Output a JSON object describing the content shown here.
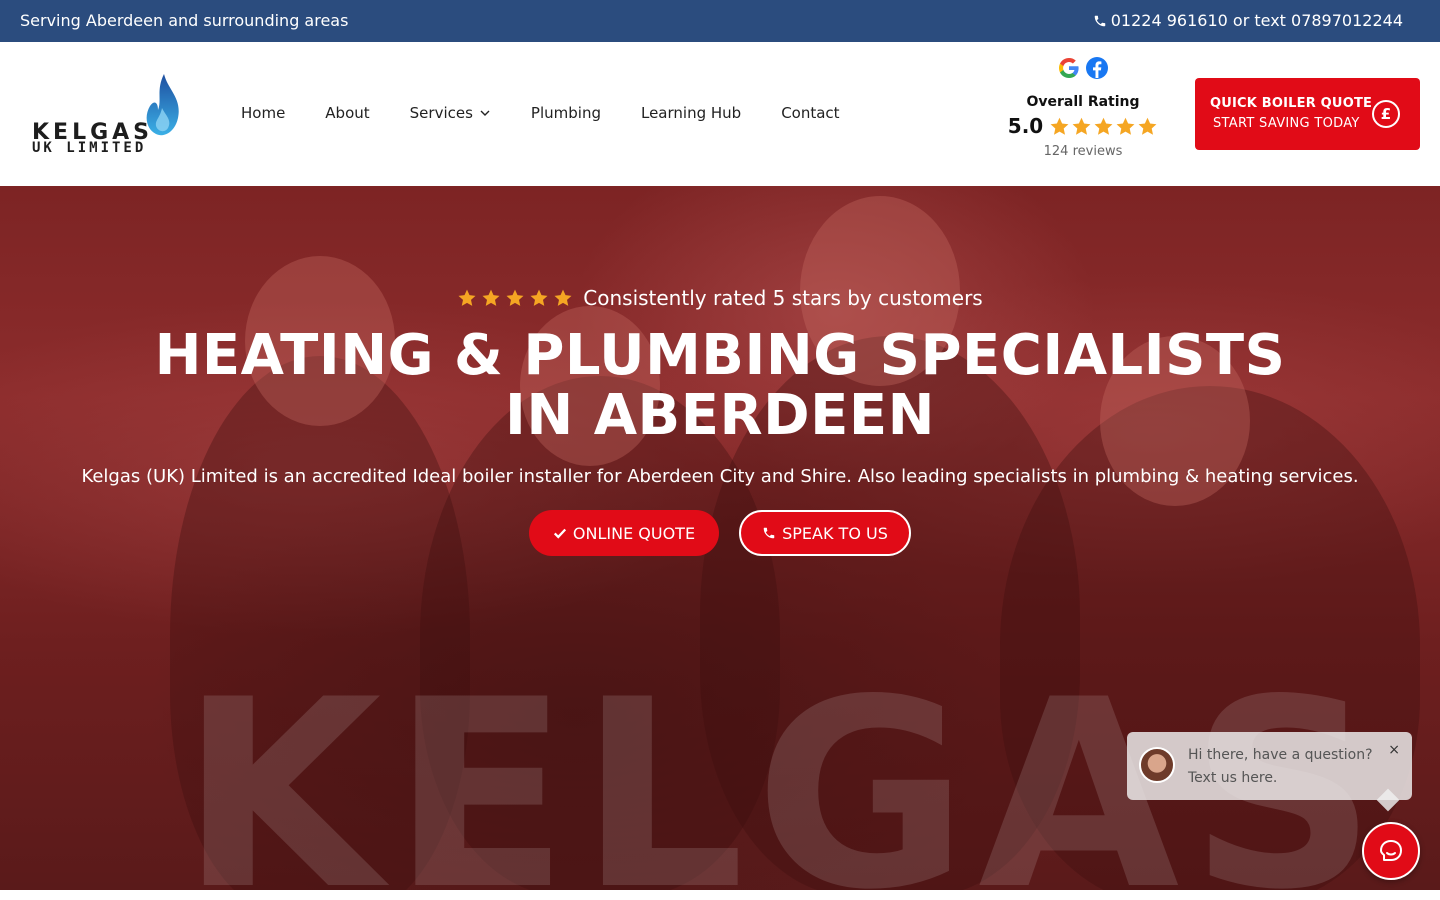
{
  "topbar": {
    "service_area": "Serving Aberdeen and surrounding areas",
    "phone": "01224 961610 or text 07897012244"
  },
  "logo": {
    "word": "KELGAS",
    "sub": "UK LIMITED"
  },
  "nav": {
    "items": [
      {
        "label": "Home"
      },
      {
        "label": "About"
      },
      {
        "label": "Services"
      },
      {
        "label": "Plumbing"
      },
      {
        "label": "Learning Hub"
      },
      {
        "label": "Contact"
      }
    ]
  },
  "rating": {
    "title": "Overall Rating",
    "score": "5.0",
    "stars": 5,
    "reviews": "124 reviews"
  },
  "cta": {
    "line1": "QUICK BOILER QUOTE",
    "line2": "START SAVING TODAY",
    "icon": "£"
  },
  "hero": {
    "tagline": "Consistently rated 5 stars by customers",
    "headline": "HEATING & PLUMBING SPECIALISTS IN ABERDEEN",
    "subline": "Kelgas (UK) Limited is an accredited Ideal boiler installer for Aberdeen City and Shire. Also leading specialists in plumbing & heating services.",
    "primary_button": "ONLINE QUOTE",
    "secondary_button": "SPEAK TO US",
    "watermark": "KELGAS"
  },
  "chat": {
    "message": "Hi there, have a question? Text us here.",
    "close": "×"
  },
  "colors": {
    "brand_blue": "#2b4c7e",
    "brand_red": "#e10b17",
    "star_gold": "#f5a623"
  }
}
